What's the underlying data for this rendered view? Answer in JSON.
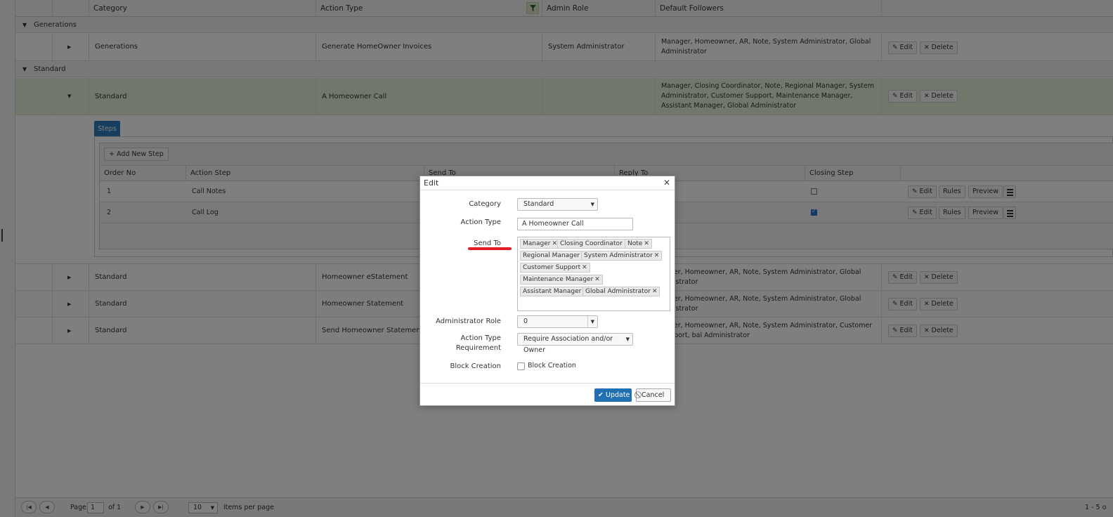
{
  "grid": {
    "headers": {
      "category": "Category",
      "action_type": "Action Type",
      "admin_role": "Admin Role",
      "default_followers": "Default Followers"
    },
    "groups": [
      "Generations",
      "Standard"
    ],
    "rows": [
      {
        "category": "Generations",
        "action_type": "Generate HomeOwner Invoices",
        "admin_role": "System Administrator",
        "followers": "Manager, Homeowner, AR, Note, System Administrator, Global Administrator"
      },
      {
        "category": "Standard",
        "action_type": "A Homeowner Call",
        "admin_role": "",
        "followers": "Manager, Closing Coordinator, Note, Regional Manager, System Administrator, Customer Support, Maintenance Manager, Assistant Manager, Global Administrator"
      },
      {
        "category": "Standard",
        "action_type": "Homeowner eStatement",
        "admin_role": "",
        "followers": "nager, Homeowner, AR, Note, System Administrator, Global ministrator"
      },
      {
        "category": "Standard",
        "action_type": "Homeowner Statement",
        "admin_role": "",
        "followers": "nager, Homeowner, AR, Note, System Administrator, Global ministrator"
      },
      {
        "category": "Standard",
        "action_type": "Send Homeowner Statement",
        "admin_role": "",
        "followers": "nager, Homeowner, AR, Note, System Administrator, Customer Support, bal Administrator"
      }
    ],
    "edit_label": "Edit",
    "delete_label": "Delete"
  },
  "steps": {
    "tab_label": "Steps",
    "add_label": "Add New Step",
    "headers": {
      "order_no": "Order No",
      "action_step": "Action Step",
      "send_to": "Send To",
      "reply_to": "Reply To",
      "closing_step": "Closing Step"
    },
    "rows": [
      {
        "order": "1",
        "step": "Call Notes",
        "closing": false
      },
      {
        "order": "2",
        "step": "Call Log",
        "closing": true
      }
    ],
    "edit_label": "Edit",
    "rules_label": "Rules",
    "preview_label": "Preview"
  },
  "pager": {
    "page_label": "Page",
    "page_value": "1",
    "of_label": "of 1",
    "page_size": "10",
    "items_label": "items per page",
    "summary": "1 - 5 o"
  },
  "modal": {
    "title": "Edit",
    "category_label": "Category",
    "category_value": "Standard",
    "action_type_label": "Action Type",
    "action_type_value": "A Homeowner Call",
    "send_to_label": "Send To",
    "send_to_tags": [
      "Manager",
      "Closing Coordinator",
      "Note",
      "Regional Manager",
      "System Administrator",
      "Customer Support",
      "Maintenance Manager",
      "Assistant Manager",
      "Global Administrator"
    ],
    "admin_role_label": "Administrator Role",
    "admin_role_value": "0",
    "requirement_label_1": "Action Type",
    "requirement_label_2": "Requirement",
    "requirement_value": "Require Association and/or Owner",
    "block_label": "Block Creation",
    "block_checkbox_label": "Block Creation",
    "update_label": "Update",
    "cancel_label": "Cancel"
  },
  "colors": {
    "primary": "#1f6fb2",
    "selected_row": "#e3f1d7",
    "annotation": "#e31e24"
  }
}
